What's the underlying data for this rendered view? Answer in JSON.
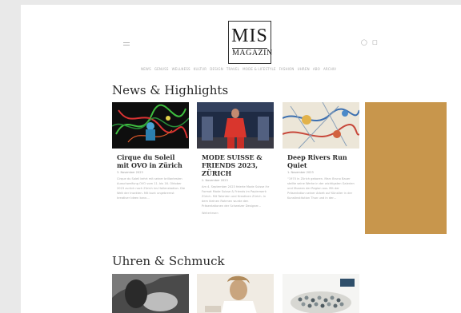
{
  "header": {
    "logo_line1": "MIS",
    "logo_line2": "MAGAZIN",
    "icons": [
      "menu-icon",
      "account-icon",
      "cart-icon"
    ]
  },
  "nav": {
    "items": [
      "NEWS",
      "GENUSS",
      "WELLNESS",
      "KULTUR",
      "DESIGN",
      "TRAVEL",
      "MODE & LIFESTYLE",
      "FASHION",
      "UHREN",
      "ABO",
      "ARCHIV"
    ]
  },
  "sections": {
    "news_title": "News & Highlights",
    "watches_title": "Uhren & Schmuck"
  },
  "cards": [
    {
      "title": "Cirque du Soleil mit OVO in Zürich",
      "date": "3. November 2023",
      "excerpt": "Cirque du Soleil kehrt mit seiner brillantesten Ausschweifung OVO vom 11. bis 16. Oktober 2023 zurück nach Zürich ins Hallenstadion. Die Welt der Insekten. Mit bunt ungebremst kreativer Ideen kann...",
      "more": ""
    },
    {
      "title": "MODE SUISSE & FRIENDS 2023, ZÜRICH",
      "date": "2. November 2023",
      "excerpt": "Am 4. September 2023 feierte Mode Suisse ihr Format Mode Suisse & Friends im Papierwerk Zürich. Mit Talenten und Kreativen Zürich. In dem kleinen Rahmen wurde den Präsentationen der Schweizer Designer...",
      "more": "Weiterlesen"
    },
    {
      "title": "Deep Rivers Run Quiet",
      "date": "1. November 2023",
      "excerpt": "“1970 in Zürich geboren. Marc Bruno Bauer stellte seine Werke in der wichtigsten Galerien und Museen der Region aus. Mit der Präsentation seiner Arbeit auf Künstler in der Kunstinstitution Thun und in der...",
      "more": ""
    }
  ],
  "advert": {
    "color": "#c8964c"
  }
}
